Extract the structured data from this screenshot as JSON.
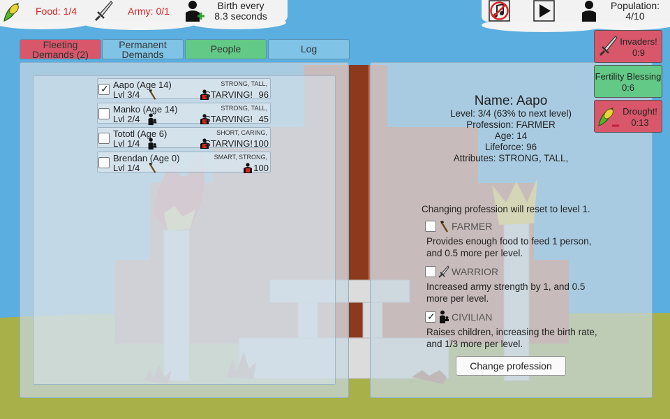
{
  "topbar": {
    "food": "Food: 1/4",
    "army": "Army: 0/1",
    "birth_line1": "Birth every",
    "birth_line2": "8.3 seconds",
    "population_label": "Population:",
    "population_value": "4/10"
  },
  "tabs": [
    {
      "label_line1": "Fleeting",
      "label_line2": "Demands (2)",
      "color": "#d9576a"
    },
    {
      "label_line1": "Permanent",
      "label_line2": "Demands",
      "color": "#7fc3e6"
    },
    {
      "label": "People",
      "color": "#63c987"
    },
    {
      "label": "Log",
      "color": "#7fc3e6"
    }
  ],
  "people": [
    {
      "name": "Aapo (Age 14)",
      "attributes": "STRONG, TALL,",
      "level": "Lvl 3/4",
      "profession_icon": "hammer-icon",
      "status": "STARVING!",
      "lifeforce": "96",
      "checked": true
    },
    {
      "name": "Manko (Age 14)",
      "attributes": "STRONG, TALL,",
      "level": "Lvl 2/4",
      "profession_icon": "baby-carrier-icon",
      "status": "STARVING!",
      "lifeforce": "45",
      "checked": false
    },
    {
      "name": "Tototl (Age 6)",
      "attributes": "SHORT, CARING,",
      "level": "Lvl 1/4",
      "profession_icon": "baby-carrier-icon",
      "status": "STARVING!",
      "lifeforce": "100",
      "checked": false
    },
    {
      "name": "Brendan (Age 0)",
      "attributes": "SMART, STRONG,",
      "level": "Lvl 1/4",
      "profession_icon": "hammer-icon",
      "status": "",
      "lifeforce": "100",
      "checked": false
    }
  ],
  "detail": {
    "name": "Name: Aapo",
    "level": "Level: 3/4 (63% to next level)",
    "profession": "Profession: FARMER",
    "age": "Age: 14",
    "lifeforce": "Lifeforce: 96",
    "attributes": "Attributes: STRONG, TALL,",
    "reset_note": "Changing profession will reset to level 1.",
    "options": [
      {
        "label": "FARMER",
        "desc": "Provides enough food to feed 1 person, and 0.5 more per level.",
        "checked": false
      },
      {
        "label": "WARRIOR",
        "desc": "Increased army strength by 1, and 0.5 more per level.",
        "checked": false
      },
      {
        "label": "CIVILIAN",
        "desc": "Raises children, increasing the birth rate, and 1/3 more per level.",
        "checked": true
      }
    ],
    "change_button": "Change profession"
  },
  "events": [
    {
      "title": "Invaders!",
      "time": "0:9",
      "color": "#d9576a"
    },
    {
      "title": "Fertility Blessing",
      "time": "0:6",
      "color": "#63c987"
    },
    {
      "title": "Drought!",
      "time": "0:13",
      "color": "#d9576a"
    }
  ]
}
